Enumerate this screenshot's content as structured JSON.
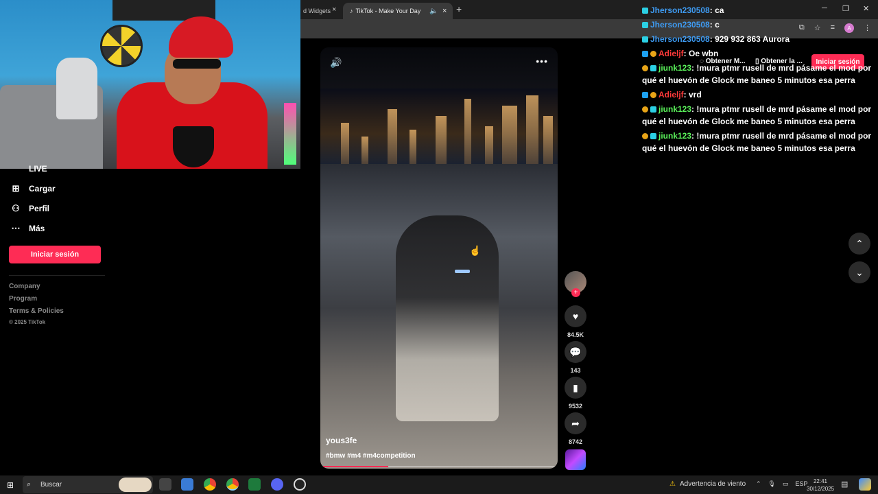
{
  "browser": {
    "tab_widgets": "d Widgets",
    "tab_active": "TikTok - Make Your Day",
    "tab_close": "×",
    "new_tab": "+",
    "minimize": "─",
    "restore": "❐",
    "close": "✕"
  },
  "tiktok_nav": {
    "live": "LIVE",
    "upload": "Cargar",
    "profile": "Perfil",
    "more": "Más",
    "login_button": "Iniciar sesión",
    "footer": [
      "Company",
      "Program",
      "Terms & Policies"
    ],
    "copyright": "© 2025 TikTok"
  },
  "tiktok_top": {
    "get_app_1": "Obtener M...",
    "get_app_2": "Obtener la ...",
    "login_button": "Iniciar sesión"
  },
  "video": {
    "username": "yous3fe",
    "hashtags": "#bmw #m4 #m4competition",
    "progress": 0.28
  },
  "actions": {
    "follow_plus": "+",
    "likes": "84.5K",
    "comments": "143",
    "saves": "9532",
    "shares": "8742"
  },
  "chat": [
    {
      "badges": [
        "cyan"
      ],
      "user": "Jherson230508",
      "user_class": "u-jherson",
      "msg": ": ca"
    },
    {
      "badges": [
        "cyan"
      ],
      "user": "Jherson230508",
      "user_class": "u-jherson",
      "msg": ": c"
    },
    {
      "badges": [
        "cyan"
      ],
      "user": "Jherson230508",
      "user_class": "u-jherson",
      "msg": ": 929 932 863 Aurora"
    },
    {
      "badges": [
        "blue",
        "gold"
      ],
      "user": "Adieljf",
      "user_class": "u-adie",
      "msg": ": Oe wbn"
    },
    {
      "badges": [
        "gold",
        "cyan"
      ],
      "user": "jiunk123",
      "user_class": "u-jiunk",
      "msg": ": !mura ptmr rusell de mrd pásame el mod por qué el huevón de Glock me baneo 5 minutos esa perra"
    },
    {
      "badges": [
        "blue",
        "gold"
      ],
      "user": "Adieljf",
      "user_class": "u-adie",
      "msg": ": vrd"
    },
    {
      "badges": [
        "gold",
        "cyan"
      ],
      "user": "jiunk123",
      "user_class": "u-jiunk",
      "msg": ": !mura ptmr rusell de mrd pásame el mod por qué el huevón de Glock me baneo 5 minutos esa perra"
    },
    {
      "badges": [
        "gold",
        "cyan"
      ],
      "user": "jiunk123",
      "user_class": "u-jiunk",
      "msg": ": !mura ptmr rusell de mrd pásame el mod por qué el huevón de Glock me baneo 5 minutos esa perra"
    }
  ],
  "taskbar": {
    "search_placeholder": "Buscar",
    "weather": "Advertencia de viento",
    "lang": "ESP",
    "time": "22:41",
    "date": "30/12/2025"
  },
  "colors": {
    "accent": "#fe2c55"
  }
}
